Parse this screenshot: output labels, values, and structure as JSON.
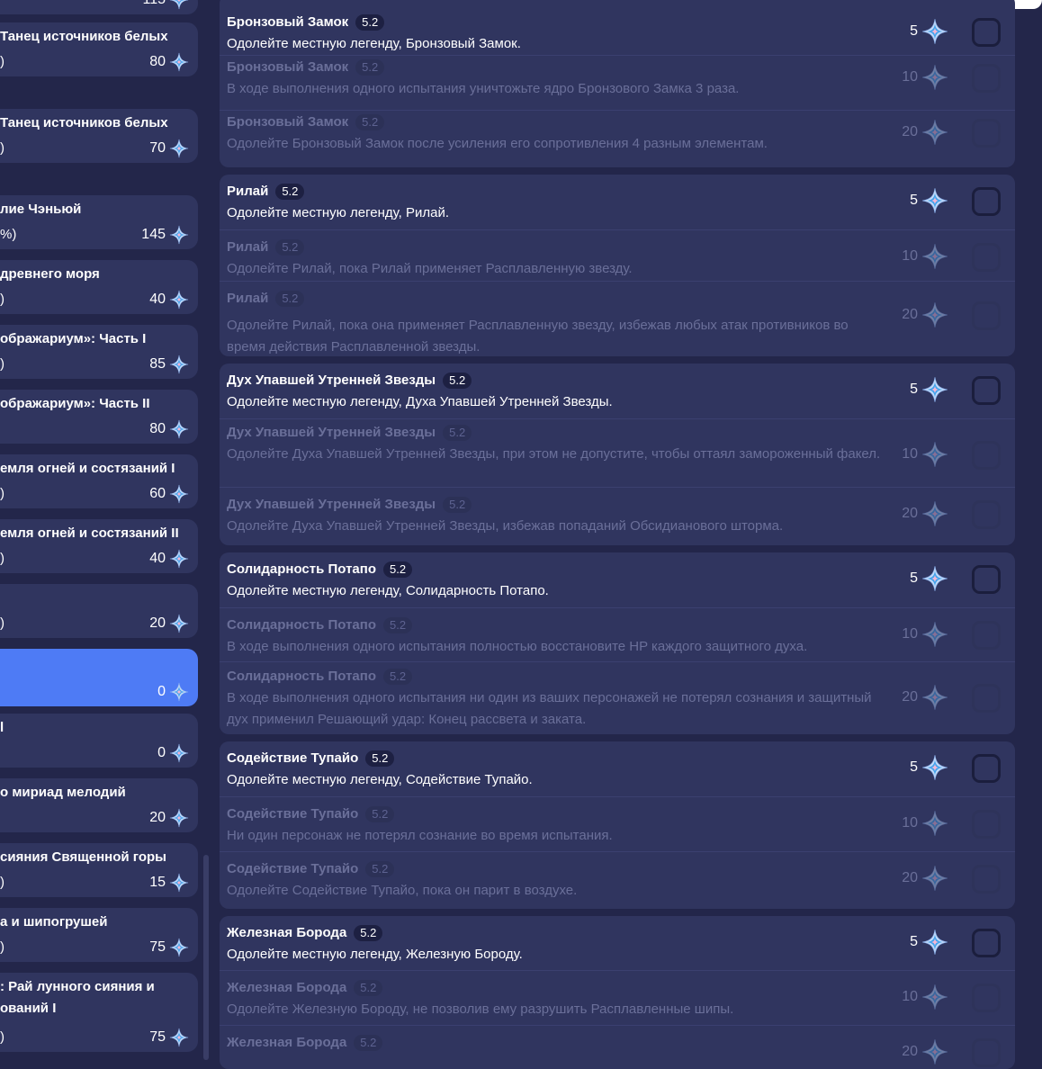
{
  "sidebar": {
    "categories": [
      {
        "title": "",
        "subtitle": "",
        "reward": "115"
      },
      {
        "title": "Танец источников белых",
        "subtitle": ")",
        "reward": "80"
      },
      {
        "title": "Танец источников белых",
        "subtitle": ")",
        "reward": "70"
      },
      {
        "title": "лие Чэньюй",
        "subtitle": "%)",
        "reward": "145"
      },
      {
        "title": "древнего моря",
        "subtitle": ")",
        "reward": "40"
      },
      {
        "title": "ображариум»: Часть I",
        "subtitle": ")",
        "reward": "85"
      },
      {
        "title": "ображариум»: Часть II",
        "subtitle": "",
        "reward": "80"
      },
      {
        "title": "емля огней и состязаний I",
        "subtitle": ")",
        "reward": "60"
      },
      {
        "title": "емля огней и состязаний II",
        "subtitle": ")",
        "reward": "40"
      },
      {
        "title": "",
        "subtitle": ")",
        "reward": "20"
      },
      {
        "title": "",
        "subtitle": "",
        "reward": "0"
      },
      {
        "title": "l",
        "subtitle": "",
        "reward": "0"
      },
      {
        "title": "о мириад мелодий",
        "subtitle": "",
        "reward": "20"
      },
      {
        "title": "сияния Священной горы",
        "subtitle": ")",
        "reward": "15"
      },
      {
        "title": "а и шипогрушей",
        "subtitle": ")",
        "reward": "75"
      },
      {
        "title": ": Рай лунного сияния и\nований I",
        "subtitle": ")",
        "reward": "75"
      }
    ]
  },
  "achievement_groups": [
    {
      "items": [
        {
          "name": "Бронзовый Замок",
          "version": "5.2",
          "desc": "Одолейте местную легенду, Бронзовый Замок.",
          "reward": "5"
        },
        {
          "name": "Бронзовый Замок",
          "version": "5.2",
          "desc": "В ходе выполнения одного испытания уничтожьте ядро Бронзового Замка 3 раза.",
          "reward": "10"
        },
        {
          "name": "Бронзовый Замок",
          "version": "5.2",
          "desc": "Одолейте Бронзовый Замок после усиления его сопротивления 4 разным элементам.",
          "reward": "20"
        }
      ]
    },
    {
      "items": [
        {
          "name": "Рилай",
          "version": "5.2",
          "desc": "Одолейте местную легенду, Рилай.",
          "reward": "5"
        },
        {
          "name": "Рилай",
          "version": "5.2",
          "desc": "Одолейте Рилай, пока Рилай применяет Расплавленную звезду.",
          "reward": "10"
        },
        {
          "name": "Рилай",
          "version": "5.2",
          "desc": "Одолейте Рилай, пока она применяет Расплавленную звезду, избежав любых атак противников во время действия Расплавленной звезды.",
          "reward": "20"
        }
      ]
    },
    {
      "items": [
        {
          "name": "Дух Упавшей Утренней Звезды",
          "version": "5.2",
          "desc": "Одолейте местную легенду, Духа Упавшей Утренней Звезды.",
          "reward": "5"
        },
        {
          "name": "Дух Упавшей Утренней Звезды",
          "version": "5.2",
          "desc": "Одолейте Духа Упавшей Утренней Звезды, при этом не допустите, чтобы оттаял замороженный факел.",
          "reward": "10"
        },
        {
          "name": "Дух Упавшей Утренней Звезды",
          "version": "5.2",
          "desc": "Одолейте Духа Упавшей Утренней Звезды, избежав попаданий Обсидианового шторма.",
          "reward": "20"
        }
      ]
    },
    {
      "items": [
        {
          "name": "Солидарность Потапо",
          "version": "5.2",
          "desc": "Одолейте местную легенду, Солидарность Потапо.",
          "reward": "5"
        },
        {
          "name": "Солидарность Потапо",
          "version": "5.2",
          "desc": "В ходе выполнения одного испытания полностью восстановите HP каждого защитного духа.",
          "reward": "10"
        },
        {
          "name": "Солидарность Потапо",
          "version": "5.2",
          "desc": "В ходе выполнения одного испытания ни один из ваших персонажей не потерял сознания и защитный дух применил Решающий удар: Конец рассвета и заката.",
          "reward": "20"
        }
      ]
    },
    {
      "items": [
        {
          "name": "Содействие Тупайо",
          "version": "5.2",
          "desc": "Одолейте местную легенду, Содействие Тупайо.",
          "reward": "5"
        },
        {
          "name": "Содействие Тупайо",
          "version": "5.2",
          "desc": "Ни один персонаж не потерял сознание во время испытания.",
          "reward": "10"
        },
        {
          "name": "Содействие Тупайо",
          "version": "5.2",
          "desc": "Одолейте Содействие Тупайо, пока он парит в воздухе.",
          "reward": "20"
        }
      ]
    },
    {
      "items": [
        {
          "name": "Железная Борода",
          "version": "5.2",
          "desc": "Одолейте местную легенду, Железную Бороду.",
          "reward": "5"
        },
        {
          "name": "Железная Борода",
          "version": "5.2",
          "desc": "Одолейте Железную Бороду, не позволив ему разрушить Расплавленные шипы.",
          "reward": "10"
        },
        {
          "name": "Железная Борода",
          "version": "5.2",
          "desc": "",
          "reward": "20"
        }
      ]
    }
  ],
  "colors": {
    "background": "#23264a",
    "card": "#30355f",
    "active_category": "#4e7bf5",
    "dim_text": "#6a6f99"
  },
  "icons": {
    "reward": "primogem-icon",
    "status": "checkbox"
  }
}
